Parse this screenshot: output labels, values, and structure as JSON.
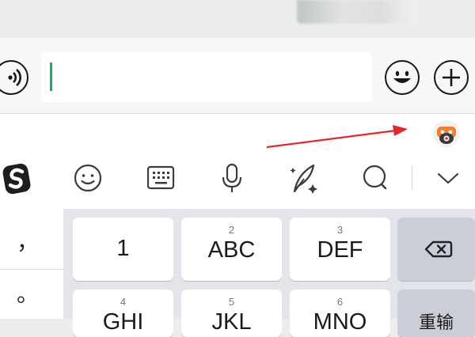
{
  "input_bar": {
    "text_value": "",
    "voice_icon": "voice-wave-icon",
    "emoji_icon": "smiley-face-icon",
    "more_icon": "plus-icon"
  },
  "toolbar": {
    "app_icon": "keyboard-app-logo-icon",
    "tools": [
      "sogou-logo-icon",
      "emoji-icon",
      "keyboard-layout-icon",
      "microphone-icon",
      "handwriting-quill-icon",
      "search-icon",
      "chevron-down-icon"
    ]
  },
  "keyboard": {
    "punct_top": "，",
    "punct_bottom": "。",
    "keys_row1": [
      {
        "main": "1",
        "num": ""
      },
      {
        "main": "ABC",
        "num": "2"
      },
      {
        "main": "DEF",
        "num": "3"
      }
    ],
    "keys_row2": [
      {
        "main": "GHI",
        "num": "4"
      },
      {
        "main": "JKL",
        "num": "5"
      },
      {
        "main": "MNO",
        "num": "6"
      }
    ],
    "backspace_icon": "backspace-icon",
    "retype_label": "重输"
  },
  "colors": {
    "caret": "#1aad5c",
    "arrow": "#e8262a",
    "key_bg": "#ffffff",
    "function_key_bg": "#cbced6"
  }
}
